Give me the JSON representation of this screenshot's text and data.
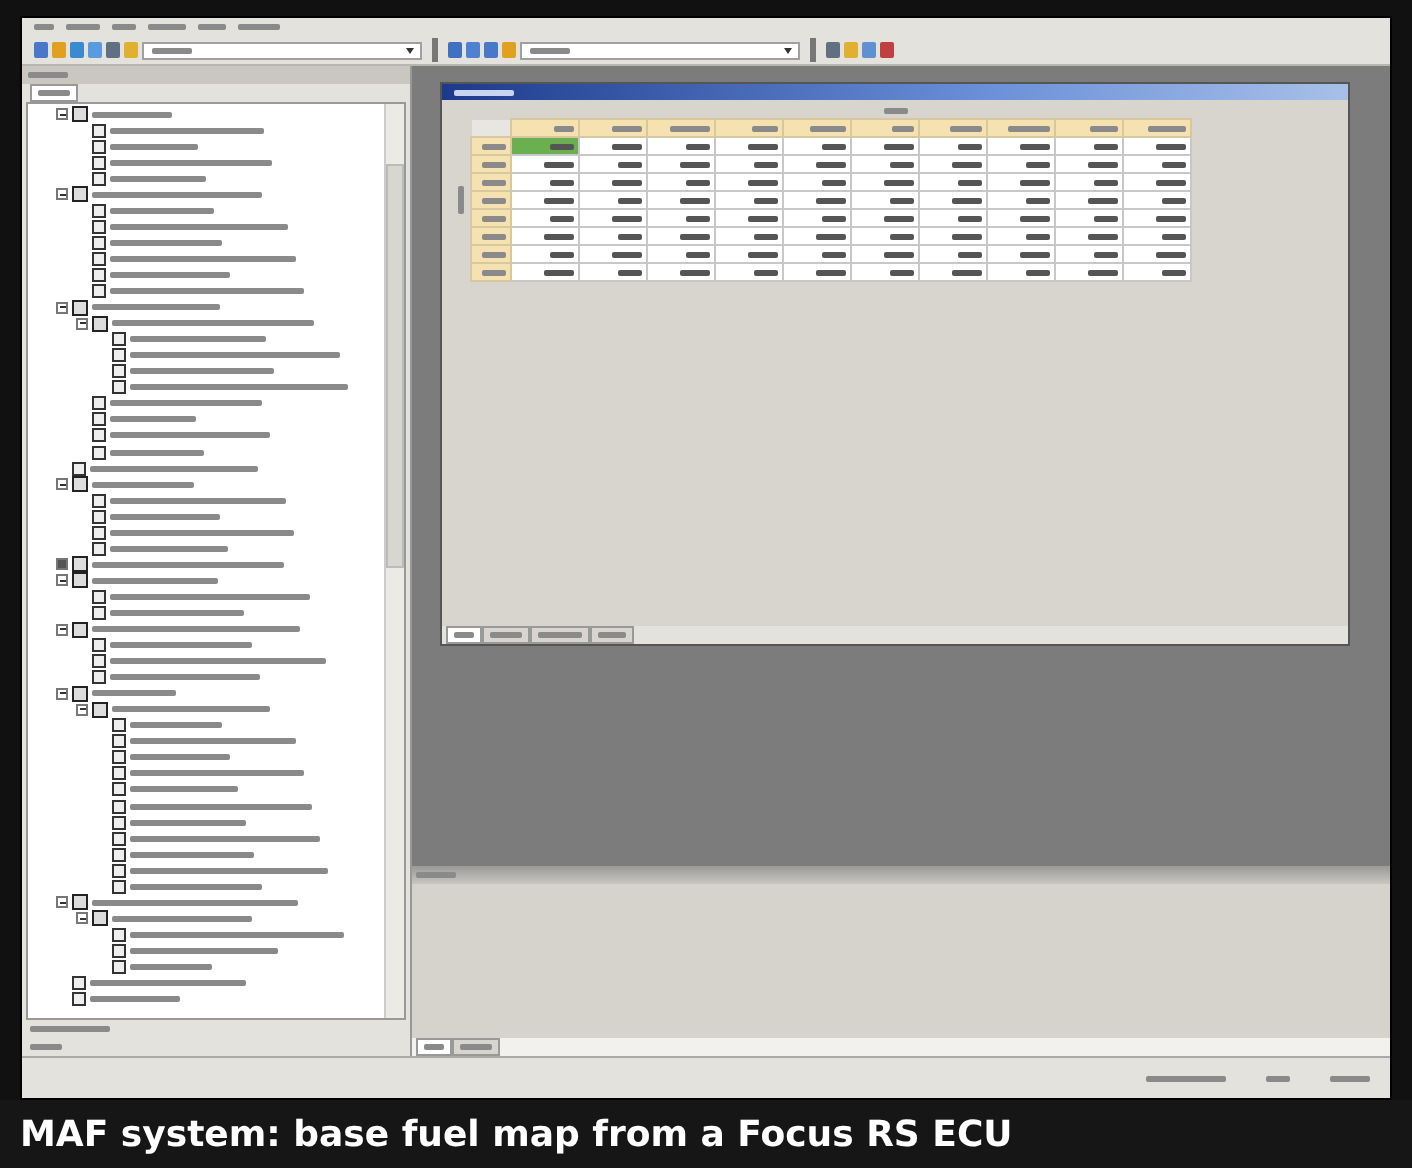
{
  "menu_bar": {
    "items": [
      {
        "kind": "illegible"
      },
      {
        "kind": "illegible"
      },
      {
        "kind": "illegible"
      },
      {
        "kind": "illegible"
      },
      {
        "kind": "illegible"
      },
      {
        "kind": "illegible"
      }
    ]
  },
  "toolbar": {
    "buttons": [
      {
        "kind": "tool"
      },
      {
        "kind": "tool"
      },
      {
        "kind": "tool"
      },
      {
        "kind": "tool"
      },
      {
        "kind": "tool"
      },
      {
        "kind": "tool"
      },
      {
        "kind": "combo"
      },
      {
        "kind": "sep"
      },
      {
        "kind": "tool"
      },
      {
        "kind": "tool"
      },
      {
        "kind": "tool"
      },
      {
        "kind": "tool"
      },
      {
        "kind": "combo"
      },
      {
        "kind": "sep"
      },
      {
        "kind": "tool"
      },
      {
        "kind": "tool"
      },
      {
        "kind": "tool"
      },
      {
        "kind": "tool"
      }
    ]
  },
  "tree": {
    "nodes": [
      {
        "kind": "folder",
        "expanded": true,
        "children": [
          {
            "kind": "entry"
          },
          {
            "kind": "entry"
          },
          {
            "kind": "entry"
          },
          {
            "kind": "entry"
          }
        ]
      },
      {
        "kind": "folder",
        "expanded": true,
        "children": [
          {
            "kind": "entry"
          },
          {
            "kind": "entry"
          },
          {
            "kind": "entry"
          },
          {
            "kind": "entry"
          },
          {
            "kind": "entry"
          },
          {
            "kind": "entry"
          }
        ]
      },
      {
        "kind": "folder",
        "expanded": true,
        "children": [
          {
            "kind": "folder",
            "expanded": true,
            "children": [
              {
                "kind": "entry"
              },
              {
                "kind": "entry"
              },
              {
                "kind": "entry"
              },
              {
                "kind": "entry"
              }
            ]
          },
          {
            "kind": "entry"
          },
          {
            "kind": "entry"
          },
          {
            "kind": "entry"
          },
          {
            "kind": "entry"
          }
        ]
      },
      {
        "kind": "entry"
      },
      {
        "kind": "folder",
        "expanded": true,
        "children": [
          {
            "kind": "entry"
          },
          {
            "kind": "entry"
          },
          {
            "kind": "entry"
          },
          {
            "kind": "entry"
          }
        ]
      },
      {
        "kind": "folder",
        "expanded": false
      },
      {
        "kind": "folder",
        "expanded": true,
        "children": [
          {
            "kind": "entry"
          },
          {
            "kind": "entry"
          }
        ]
      },
      {
        "kind": "folder",
        "expanded": true,
        "children": [
          {
            "kind": "entry"
          },
          {
            "kind": "entry"
          },
          {
            "kind": "entry"
          }
        ]
      },
      {
        "kind": "folder",
        "expanded": true,
        "children": [
          {
            "kind": "folder",
            "expanded": true,
            "children": [
              {
                "kind": "entry"
              },
              {
                "kind": "entry"
              },
              {
                "kind": "entry"
              },
              {
                "kind": "entry"
              },
              {
                "kind": "entry"
              },
              {
                "kind": "entry"
              },
              {
                "kind": "entry"
              },
              {
                "kind": "entry"
              },
              {
                "kind": "entry"
              },
              {
                "kind": "entry"
              },
              {
                "kind": "entry"
              }
            ]
          }
        ]
      },
      {
        "kind": "folder",
        "expanded": true,
        "children": [
          {
            "kind": "folder",
            "expanded": true,
            "children": [
              {
                "kind": "entry"
              },
              {
                "kind": "entry"
              },
              {
                "kind": "entry"
              }
            ]
          }
        ]
      },
      {
        "kind": "entry"
      },
      {
        "kind": "entry"
      }
    ]
  },
  "table": {
    "rows": [
      {
        "cells": [
          {
            "selected": true
          },
          {
            "selected": false
          },
          {
            "selected": false
          },
          {
            "selected": false
          },
          {
            "selected": false
          },
          {
            "selected": false
          },
          {
            "selected": false
          },
          {
            "selected": false
          },
          {
            "selected": false
          },
          {
            "selected": false
          }
        ]
      },
      {
        "cells": [
          {
            "selected": false
          },
          {
            "selected": false
          },
          {
            "selected": false
          },
          {
            "selected": false
          },
          {
            "selected": false
          },
          {
            "selected": false
          },
          {
            "selected": false
          },
          {
            "selected": false
          },
          {
            "selected": false
          },
          {
            "selected": false
          }
        ]
      },
      {
        "cells": [
          {
            "selected": false
          },
          {
            "selected": false
          },
          {
            "selected": false
          },
          {
            "selected": false
          },
          {
            "selected": false
          },
          {
            "selected": false
          },
          {
            "selected": false
          },
          {
            "selected": false
          },
          {
            "selected": false
          },
          {
            "selected": false
          }
        ]
      },
      {
        "cells": [
          {
            "selected": false
          },
          {
            "selected": false
          },
          {
            "selected": false
          },
          {
            "selected": false
          },
          {
            "selected": false
          },
          {
            "selected": false
          },
          {
            "selected": false
          },
          {
            "selected": false
          },
          {
            "selected": false
          },
          {
            "selected": false
          }
        ]
      },
      {
        "cells": [
          {
            "selected": false
          },
          {
            "selected": false
          },
          {
            "selected": false
          },
          {
            "selected": false
          },
          {
            "selected": false
          },
          {
            "selected": false
          },
          {
            "selected": false
          },
          {
            "selected": false
          },
          {
            "selected": false
          },
          {
            "selected": false
          }
        ]
      },
      {
        "cells": [
          {
            "selected": false
          },
          {
            "selected": false
          },
          {
            "selected": false
          },
          {
            "selected": false
          },
          {
            "selected": false
          },
          {
            "selected": false
          },
          {
            "selected": false
          },
          {
            "selected": false
          },
          {
            "selected": false
          },
          {
            "selected": false
          }
        ]
      },
      {
        "cells": [
          {
            "selected": false
          },
          {
            "selected": false
          },
          {
            "selected": false
          },
          {
            "selected": false
          },
          {
            "selected": false
          },
          {
            "selected": false
          },
          {
            "selected": false
          },
          {
            "selected": false
          },
          {
            "selected": false
          },
          {
            "selected": false
          }
        ]
      },
      {
        "cells": [
          {
            "selected": false
          },
          {
            "selected": false
          },
          {
            "selected": false
          },
          {
            "selected": false
          },
          {
            "selected": false
          },
          {
            "selected": false
          },
          {
            "selected": false
          },
          {
            "selected": false
          },
          {
            "selected": false
          },
          {
            "selected": false
          }
        ]
      }
    ]
  },
  "window_tabs": [
    {
      "selected": true
    },
    {
      "selected": false
    },
    {
      "selected": false
    },
    {
      "selected": false
    }
  ],
  "panel_tabs": [
    {
      "selected": true
    },
    {
      "selected": false
    }
  ],
  "caption": "MAF system: base fuel map from a Focus RS ECU"
}
